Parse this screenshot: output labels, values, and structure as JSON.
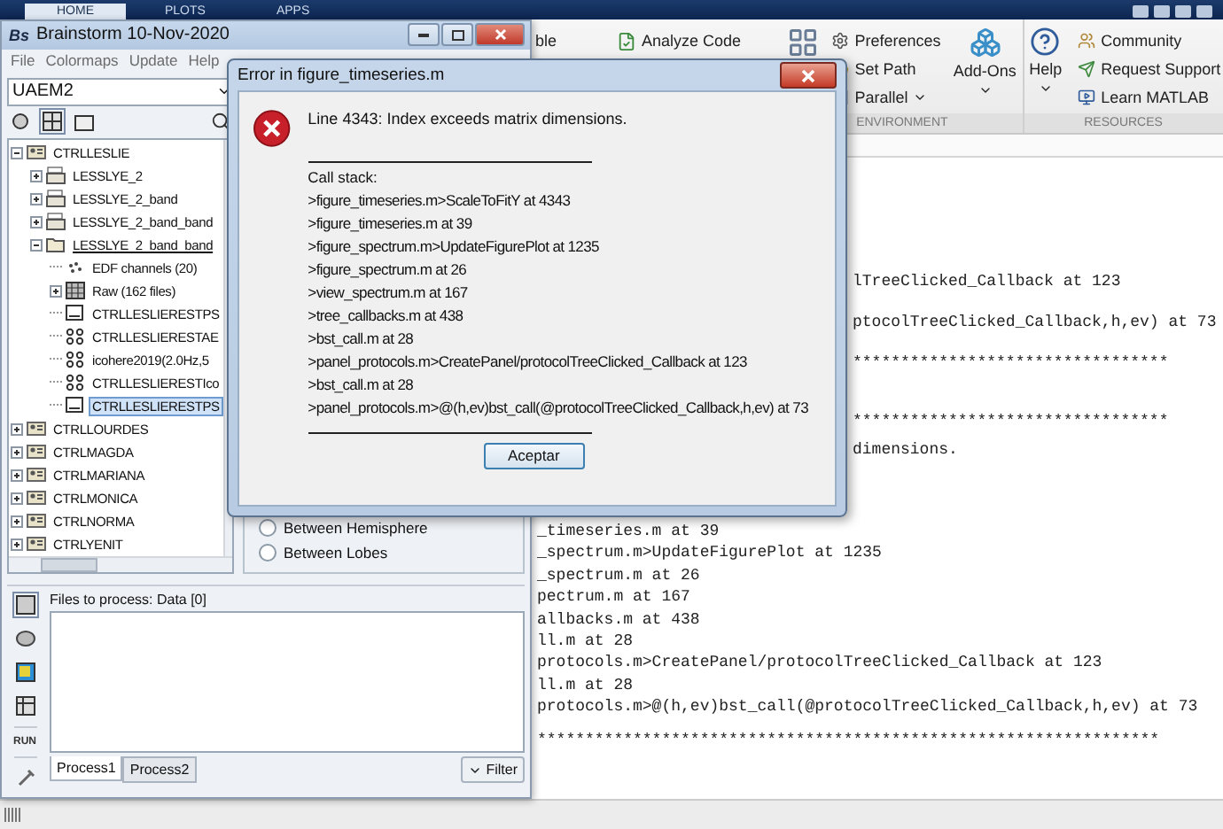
{
  "matlab": {
    "tabs": [
      {
        "label": "HOME",
        "selected": true
      },
      {
        "label": "PLOTS",
        "selected": false
      },
      {
        "label": "APPS",
        "selected": false
      }
    ],
    "toolstrip": {
      "code_items": [
        {
          "label": "ble",
          "kind": "plain"
        },
        {
          "label": "Analyze Code",
          "kind": "analyze"
        }
      ],
      "environment": {
        "label": "ENVIRONMENT",
        "items": [
          {
            "label": "Preferences",
            "kind": "gear",
            "dropdown": false
          },
          {
            "label": "Set Path",
            "kind": "folder",
            "dropdown": false
          },
          {
            "label": "Parallel",
            "kind": "parallel",
            "dropdown": true
          }
        ],
        "add_ons": "Add-Ons"
      },
      "resources": {
        "label": "RESOURCES",
        "help": "Help",
        "items": [
          {
            "label": "Community",
            "kind": "people"
          },
          {
            "label": "Request Support",
            "kind": "support"
          },
          {
            "label": "Learn MATLAB",
            "kind": "learn"
          }
        ]
      }
    },
    "console": {
      "upper_lines": [
        "lTreeClicked_Callback at 123",
        "ptocolTreeClicked_Callback,h,ev) at 73",
        "*********************************"
      ],
      "middle_lines": [
        "*********************************",
        "dimensions."
      ],
      "lower_lines": [
        "_timeseries.m at 39",
        "_spectrum.m>UpdateFigurePlot at 1235",
        "_spectrum.m at 26",
        "pectrum.m at 167",
        "allbacks.m at 438",
        "ll.m at 28",
        "protocols.m>CreatePanel/protocolTreeClicked_Callback at 123",
        "ll.m at 28",
        "protocols.m>@(h,ev)bst_call(@protocolTreeClicked_Callback,h,ev) at 73"
      ],
      "closing_line": "*****************************************************************"
    }
  },
  "brainstorm": {
    "logo": "Bs",
    "title": "Brainstorm 10-Nov-2020",
    "menu": [
      "File",
      "Colormaps",
      "Update",
      "Help"
    ],
    "protocol": "UAEM2",
    "tree": [
      {
        "label": "CTRLLESLIE",
        "kind": "subject",
        "expanded": true,
        "selected": false,
        "children": [
          {
            "label": "LESSLYE_2",
            "kind": "raw-folder",
            "expanded": false,
            "current": false,
            "selected": false
          },
          {
            "label": "LESSLYE_2_band",
            "kind": "raw-folder",
            "expanded": false,
            "current": false,
            "selected": false
          },
          {
            "label": "LESSLYE_2_band_band",
            "kind": "raw-folder",
            "expanded": false,
            "current": false,
            "selected": false
          },
          {
            "label": "LESSLYE_2_band_band",
            "kind": "open-folder",
            "expanded": true,
            "current": true,
            "selected": false,
            "children": [
              {
                "label": "EDF channels (20)",
                "kind": "channels",
                "selected": false
              },
              {
                "label": "Raw (162 files)",
                "kind": "raw-files",
                "expanded": false,
                "selected": false
              },
              {
                "label": "CTRLLESLIERESTPS",
                "kind": "timefreq",
                "selected": false
              },
              {
                "label": "CTRLLESLIERESTAE",
                "kind": "connect",
                "selected": false
              },
              {
                "label": "icohere2019(2.0Hz,5",
                "kind": "connect",
                "selected": false
              },
              {
                "label": "CTRLLESLIERESTIco",
                "kind": "connect",
                "selected": false
              },
              {
                "label": "CTRLLESLIERESTPS",
                "kind": "timefreq",
                "selected": true
              }
            ]
          }
        ]
      },
      {
        "label": "CTRLLOURDES",
        "kind": "subject",
        "expanded": false,
        "selected": false
      },
      {
        "label": "CTRLMAGDA",
        "kind": "subject",
        "expanded": false,
        "selected": false
      },
      {
        "label": "CTRLMARIANA",
        "kind": "subject",
        "expanded": false,
        "selected": false
      },
      {
        "label": "CTRLMONICA",
        "kind": "subject",
        "expanded": false,
        "selected": false
      },
      {
        "label": "CTRLNORMA",
        "kind": "subject",
        "expanded": false,
        "selected": false
      },
      {
        "label": "CTRLYENIT",
        "kind": "subject",
        "expanded": false,
        "selected": false
      }
    ],
    "options": [
      {
        "label": "Between Hemisphere",
        "selected": false
      },
      {
        "label": "Between Lobes",
        "selected": false
      }
    ],
    "process": {
      "files_label": "Files to process: Data [0]",
      "run": "RUN",
      "tabs": [
        {
          "label": "Process1",
          "selected": true
        },
        {
          "label": "Process2",
          "selected": false
        }
      ],
      "filter": "Filter"
    }
  },
  "dialog": {
    "title": "Error in figure_timeseries.m",
    "message": "Line 4343: Index exceeds matrix dimensions.",
    "stack_label": "Call stack:",
    "stack": [
      ">figure_timeseries.m>ScaleToFitY at 4343",
      ">figure_timeseries.m at 39",
      ">figure_spectrum.m>UpdateFigurePlot at 1235",
      ">figure_spectrum.m at 26",
      ">view_spectrum.m at 167",
      ">tree_callbacks.m at 438",
      ">bst_call.m at 28",
      ">panel_protocols.m>CreatePanel/protocolTreeClicked_Callback at 123",
      ">bst_call.m at 28",
      ">panel_protocols.m>@(h,ev)bst_call(@protocolTreeClicked_Callback,h,ev) at 73"
    ],
    "button": "Aceptar"
  }
}
